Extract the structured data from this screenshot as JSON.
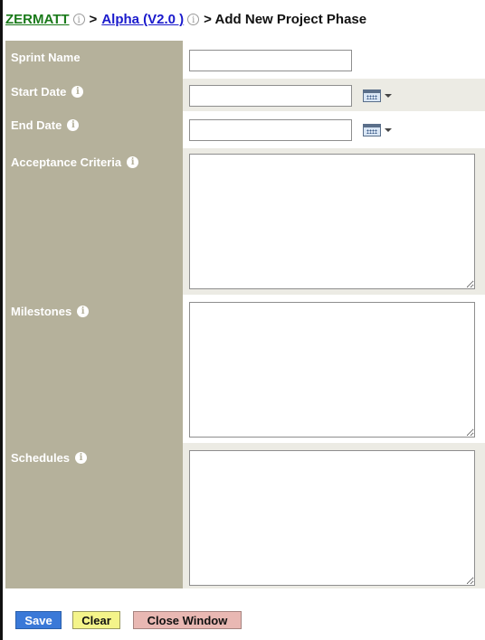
{
  "breadcrumb": {
    "root": "ZERMATT",
    "project": "Alpha (V2.0 )",
    "page_title": "> Add New Project Phase",
    "separator": ">",
    "info_icon": "info-circle-outline-icon"
  },
  "form": {
    "sprint_name": {
      "label": "Sprint Name",
      "value": ""
    },
    "start_date": {
      "label": "Start Date",
      "value": "",
      "picker_icon": "calendar-icon"
    },
    "end_date": {
      "label": "End Date",
      "value": "",
      "picker_icon": "calendar-icon"
    },
    "acceptance_criteria": {
      "label": "Acceptance Criteria",
      "value": ""
    },
    "milestones": {
      "label": "Milestones",
      "value": ""
    },
    "schedules": {
      "label": "Schedules",
      "value": ""
    },
    "info_icon": "info-circle-icon"
  },
  "actions": {
    "save": "Save",
    "clear": "Clear",
    "close": "Close Window"
  },
  "colors": {
    "label_column": "#b5b19b",
    "alt_row": "#ecebe4",
    "save": "#3a79d8",
    "clear": "#f4f48a",
    "close": "#e9b8b3",
    "root_link": "#1a7a1a",
    "project_link": "#1a1acc"
  }
}
